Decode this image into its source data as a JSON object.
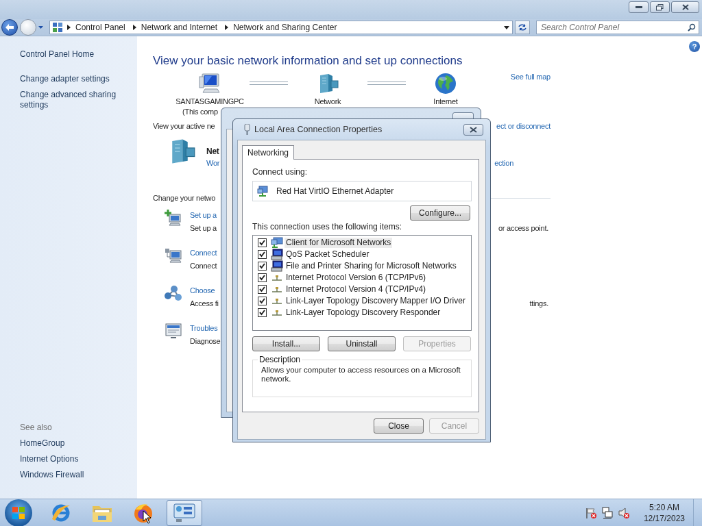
{
  "window": {
    "breadcrumbs": [
      "Control Panel",
      "Network and Internet",
      "Network and Sharing Center"
    ],
    "search": {
      "placeholder": "Search Control Panel"
    },
    "help_button": "?"
  },
  "sidebar": {
    "items": [
      "Control Panel Home",
      "Change adapter settings",
      "Change advanced sharing settings"
    ],
    "see_also_title": "See also",
    "see_also": [
      "HomeGroup",
      "Internet Options",
      "Windows Firewall"
    ]
  },
  "main": {
    "heading": "View your basic network information and set up connections",
    "see_full_map": "See full map",
    "map_nodes": [
      {
        "kind": "computer",
        "label": "SANTASGAMINGPC",
        "sublabel": "(This comp"
      },
      {
        "kind": "network",
        "label": "Network"
      },
      {
        "kind": "internet",
        "label": "Internet"
      }
    ],
    "active_networks_label": "View your active ne",
    "connect_link": "ect or disconnect",
    "network_name": "Net",
    "network_type": "Wor",
    "connection_link": "ection",
    "change_label": "Change your netwo",
    "tasks": [
      {
        "kind": "setup",
        "link": "Set up a",
        "description": "Set up a",
        "description_tail": "or access point."
      },
      {
        "kind": "connect",
        "link": "Connect",
        "description": "Connect"
      },
      {
        "kind": "homegroup",
        "link": "Choose",
        "description": "Access fi",
        "description_tail": "ttings."
      },
      {
        "kind": "troubleshoot",
        "link": "Troubles",
        "description": "Diagnose"
      }
    ]
  },
  "dialog": {
    "title": "Local Area Connection Properties",
    "tabs": [
      {
        "label": "Networking",
        "selected": true
      }
    ],
    "connect_using_label": "Connect using:",
    "adapter": "Red Hat VirtIO Ethernet Adapter",
    "configure_button": "Configure...",
    "items_label": "This connection uses the following items:",
    "items": [
      {
        "kind": "client",
        "label": "Client for Microsoft Networks",
        "checked": true,
        "selected": true
      },
      {
        "kind": "service",
        "label": "QoS Packet Scheduler",
        "checked": true,
        "selected": false
      },
      {
        "kind": "service",
        "label": "File and Printer Sharing for Microsoft Networks",
        "checked": true,
        "selected": false
      },
      {
        "kind": "protocol",
        "label": "Internet Protocol Version 6 (TCP/IPv6)",
        "checked": true,
        "selected": false
      },
      {
        "kind": "protocol",
        "label": "Internet Protocol Version 4 (TCP/IPv4)",
        "checked": true,
        "selected": false
      },
      {
        "kind": "protocol",
        "label": "Link-Layer Topology Discovery Mapper I/O Driver",
        "checked": true,
        "selected": false
      },
      {
        "kind": "protocol",
        "label": "Link-Layer Topology Discovery Responder",
        "checked": true,
        "selected": false
      }
    ],
    "buttons": [
      {
        "label": "Install...",
        "disabled": false
      },
      {
        "label": "Uninstall",
        "disabled": false
      },
      {
        "label": "Properties",
        "disabled": true
      }
    ],
    "description_title": "Description",
    "description": "Allows your computer to access resources on a Microsoft network.",
    "footer_buttons": [
      {
        "label": "Close",
        "disabled": false
      },
      {
        "label": "Cancel",
        "disabled": true
      }
    ]
  },
  "taskbar": {
    "apps": [
      {
        "kind": "browser",
        "selected": false
      },
      {
        "kind": "folder",
        "selected": false
      },
      {
        "kind": "fox",
        "selected": false
      },
      {
        "kind": "control-panel",
        "selected": true
      }
    ],
    "time": "5:20 AM",
    "date": "12/17/2023"
  }
}
